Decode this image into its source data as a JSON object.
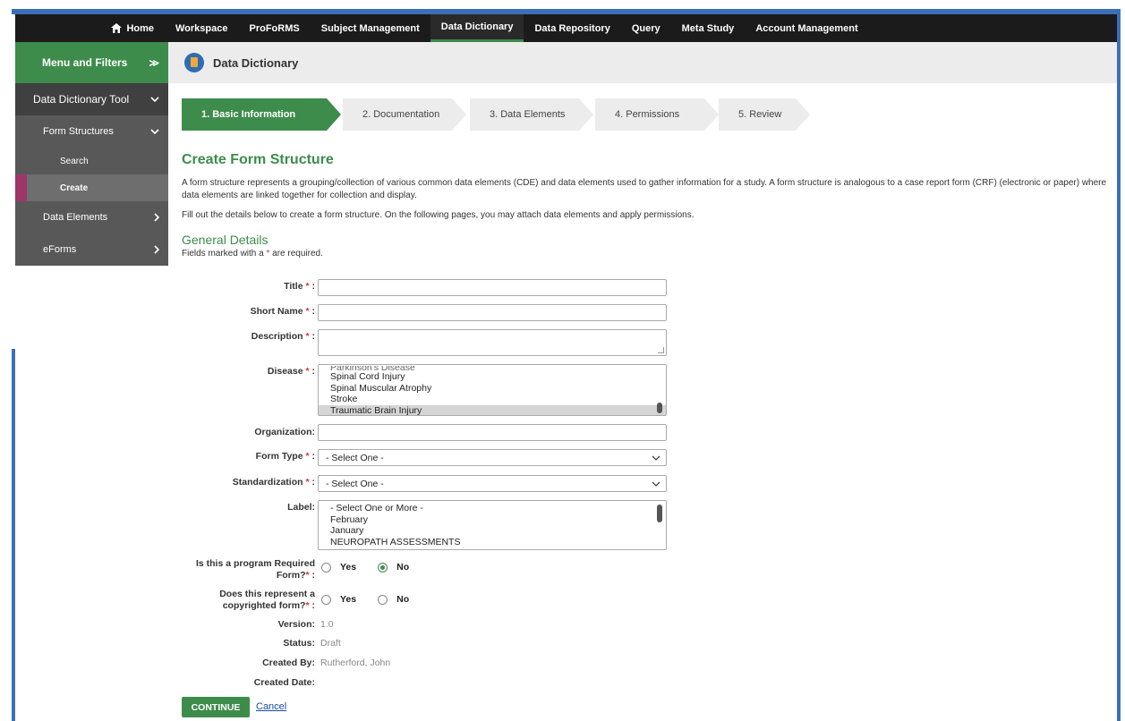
{
  "topnav": {
    "home": "Home",
    "items": [
      "Workspace",
      "ProFoRMS",
      "Subject Management",
      "Data Dictionary",
      "Data Repository",
      "Query",
      "Meta Study",
      "Account Management"
    ],
    "active": "Data Dictionary"
  },
  "sidebar": {
    "header": "Menu and Filters",
    "tool": "Data Dictionary Tool",
    "form_structures": "Form Structures",
    "search": "Search",
    "create": "Create",
    "data_elements": "Data Elements",
    "eforms": "eForms"
  },
  "page_header": {
    "title": "Data Dictionary"
  },
  "steps": [
    "1. Basic Information",
    "2. Documentation",
    "3. Data Elements",
    "4. Permissions",
    "5. Review"
  ],
  "main": {
    "title": "Create Form Structure",
    "description": "A form structure represents a grouping/collection of various common data elements (CDE) and data elements used to gather information for a study. A form structure is analogous to a case report form (CRF) (electronic or paper) where data elements are linked together for collection and display.",
    "instructions": "Fill out the details below to create a form structure. On the following pages, you may attach data elements and apply permissions.",
    "section_title": "General Details",
    "required_note_pre": "Fields marked with a ",
    "required_note_star": "*",
    "required_note_post": " are required."
  },
  "form": {
    "title_label": "Title",
    "short_name_label": "Short Name",
    "description_label": "Description",
    "disease_label": "Disease",
    "disease_options_cut": "Parkinson's Disease",
    "disease_options": [
      "Spinal Cord Injury",
      "Spinal Muscular Atrophy",
      "Stroke",
      "Traumatic Brain Injury"
    ],
    "disease_selected": "Traumatic Brain Injury",
    "organization_label": "Organization:",
    "form_type_label": "Form Type",
    "form_type_value": "- Select One -",
    "standardization_label": "Standardization",
    "standardization_value": "- Select One -",
    "label_label": "Label:",
    "label_options": [
      "- Select One or More -",
      "February",
      "January",
      "NEUROPATH ASSESSMENTS"
    ],
    "program_required_label_1": "Is this a program Required",
    "program_required_label_2": "Form?",
    "copyrighted_label_1": "Does this represent a",
    "copyrighted_label_2": "copyrighted form?",
    "yes": "Yes",
    "no": "No",
    "program_required_value": "No",
    "version_label": "Version:",
    "version_value": "1.0",
    "status_label": "Status:",
    "status_value": "Draft",
    "created_by_label": "Created By:",
    "created_by_value": "Rutherford, John",
    "created_date_label": "Created Date:",
    "star": "*",
    "colon": ":"
  },
  "actions": {
    "continue": "CONTINUE",
    "cancel": "Cancel"
  },
  "colors": {
    "accent_green": "#3d8c4c",
    "nav_dark": "#1b1b1b",
    "sidebar_gray": "#585858",
    "active_marker": "#a0356b",
    "frame_blue": "#3d6fb8"
  }
}
